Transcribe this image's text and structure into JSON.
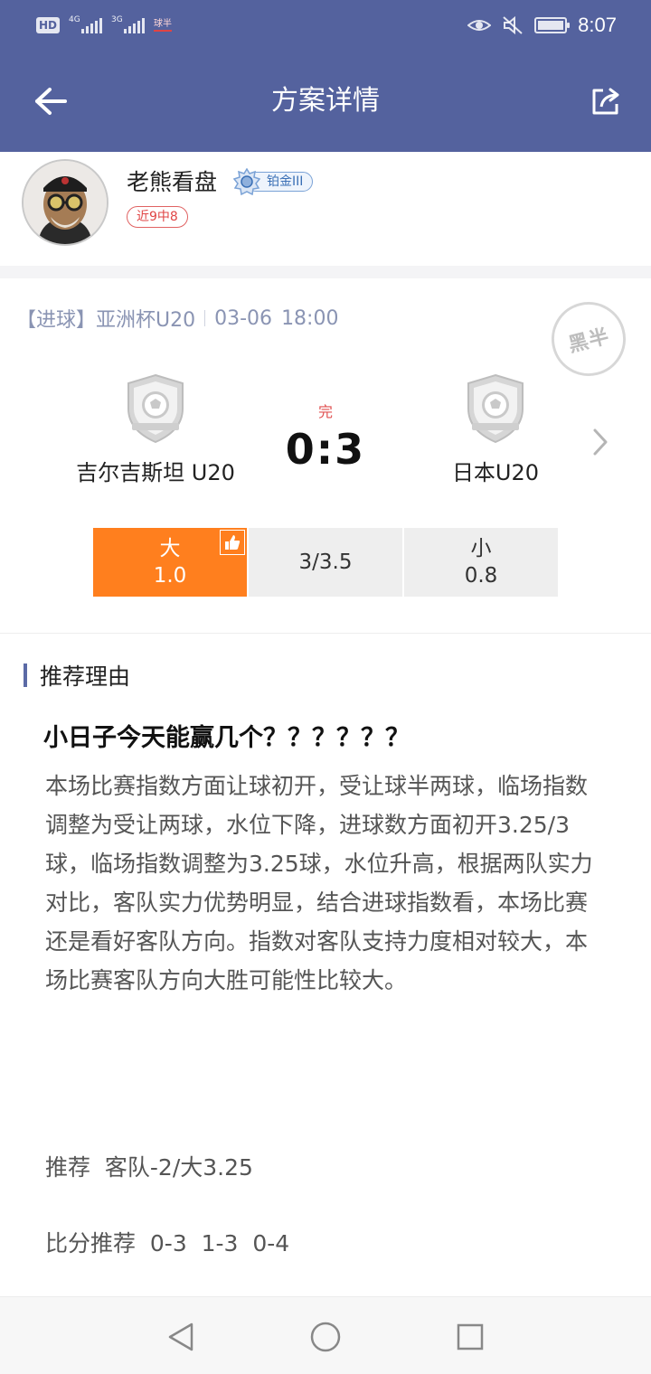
{
  "status_bar": {
    "hd": "HD",
    "net1": "4G",
    "net2": "3G",
    "app_label": "球半",
    "time": "8:07"
  },
  "header": {
    "title": "方案详情",
    "icons": [
      "back-arrow-icon",
      "share-icon"
    ]
  },
  "author": {
    "name": "老熊看盘",
    "rank": "铂金III",
    "record": "近9中8"
  },
  "match": {
    "category": "【进球】",
    "league": "亚洲杯U20",
    "date": "03-06",
    "time": "18:00",
    "stamp": "黑半",
    "status": "完",
    "score": "0:3",
    "home_team": "吉尔吉斯坦 U20",
    "away_team": "日本U20",
    "odds": {
      "over_label": "大",
      "over_value": "1.0",
      "line": "3/3.5",
      "under_label": "小",
      "under_value": "0.8",
      "selected": "over"
    }
  },
  "reason": {
    "section_title": "推荐理由",
    "title": "小日子今天能赢几个？？？？？？",
    "body": "本场比赛指数方面让球初开，受让球半两球，临场指数调整为受让两球，水位下降，进球数方面初开3.25/3球，临场指数调整为3.25球，水位升高，根据两队实力对比，客队实力优势明显，结合进球指数看，本场比赛还是看好客队方向。指数对客队支持力度相对较大，本场比赛客队方向大胜可能性比较大。",
    "recommend": "推荐  客队-2/大3.25",
    "score_recommend": "比分推荐  0-3  1-3  0-4"
  },
  "colors": {
    "header": "#54629e",
    "accent": "#ff7f1e",
    "status_red": "#e05050"
  }
}
